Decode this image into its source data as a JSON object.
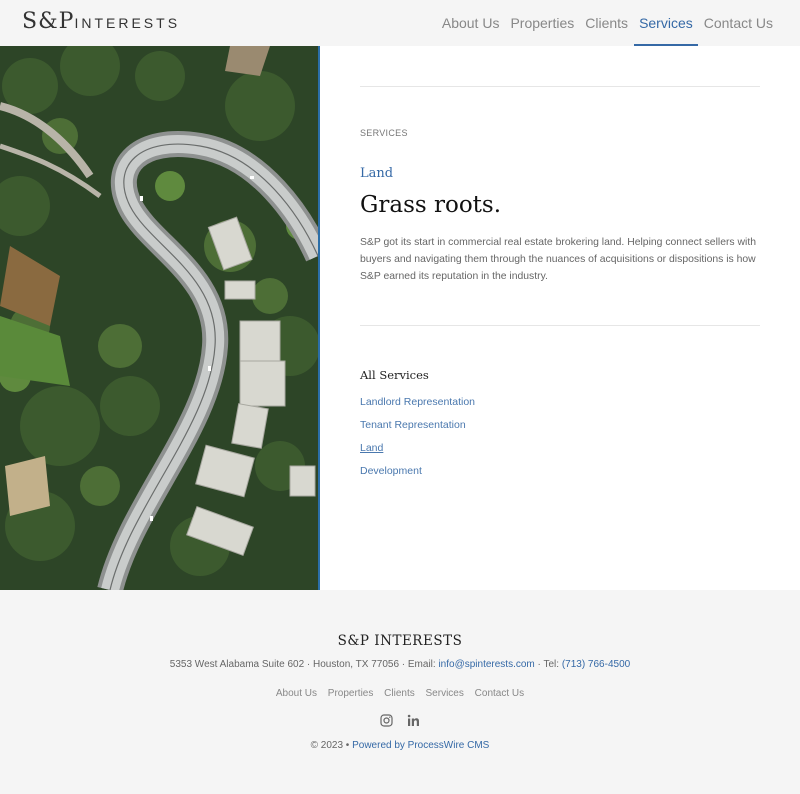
{
  "header": {
    "logo_main": "S&P",
    "logo_sub": "INTERESTS",
    "nav": [
      {
        "label": "About Us"
      },
      {
        "label": "Properties"
      },
      {
        "label": "Clients"
      },
      {
        "label": "Services",
        "active": true
      },
      {
        "label": "Contact Us"
      }
    ]
  },
  "main": {
    "eyebrow": "SERVICES",
    "subtitle": "Land",
    "title": "Grass roots.",
    "body": "S&P got its start in commercial real estate brokering land. Helping connect sellers with buyers and navigating them through the nuances of acquisitions or dispositions is how S&P earned its reputation in the industry.",
    "list_heading": "All Services",
    "services": [
      {
        "label": "Landlord Representation"
      },
      {
        "label": "Tenant Representation"
      },
      {
        "label": "Land",
        "current": true
      },
      {
        "label": "Development"
      }
    ]
  },
  "hero": {
    "icon": "aerial-road-photo"
  },
  "footer": {
    "brand": "S&P INTERESTS",
    "address": "5353 West Alabama Suite 602 · Houston, TX 77056 · Email: ",
    "email": "info@spinterests.com",
    "tel_prefix": " · Tel: ",
    "tel": "(713) 766-4500",
    "nav": [
      "About Us",
      "Properties",
      "Clients",
      "Services",
      "Contact Us"
    ],
    "social": [
      "instagram-icon",
      "linkedin-icon"
    ],
    "copyright": "© 2023 • ",
    "powered": "Powered by ProcessWire CMS"
  },
  "colors": {
    "accent": "#3569a6",
    "header_bg": "#f5f5f5"
  }
}
